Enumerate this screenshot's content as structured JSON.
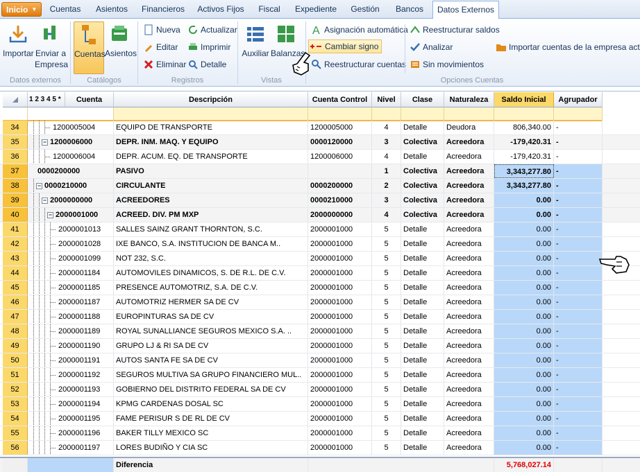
{
  "menu": {
    "inicio": "Inicio",
    "tabs": [
      "Cuentas",
      "Asientos",
      "Financieros",
      "Activos Fijos",
      "Fiscal",
      "Expediente",
      "Gestión",
      "Bancos",
      "Datos Externos"
    ]
  },
  "ribbon": {
    "importar": "Importar",
    "enviar_line1": "Enviar a",
    "enviar_line2": "Empresa",
    "datos_externos": "Datos externos",
    "cuentas": "Cuentas",
    "asientos": "Asientos",
    "catalogos": "Catálogos",
    "nueva": "Nueva",
    "actualizar": "Actualizar",
    "editar": "Editar",
    "imprimir": "Imprimir",
    "eliminar": "Eliminar",
    "detalle": "Detalle",
    "registros": "Registros",
    "auxiliar": "Auxiliar",
    "balanzas": "Balanzas",
    "vistas": "Vistas",
    "asignacion_automatica": "Asignación automática",
    "cambiar_signo": "Cambiar signo",
    "reestructurar_cuentas": "Reestructurar cuentas",
    "reestructurar_saldos": "Reestructurar saldos",
    "analizar": "Analizar",
    "sin_movimientos": "Sin movimientos",
    "importar_cuentas_empresa": "Importar cuentas de la empresa actual",
    "opciones_cuentas": "Opciones Cuentas"
  },
  "grid": {
    "level_header": "1 2 3 4 5 *",
    "columns": [
      "Cuenta",
      "Descripción",
      "Cuenta Control",
      "Nivel",
      "Clase",
      "Naturaleza",
      "Saldo Inicial",
      "Agrupador"
    ],
    "rows": [
      {
        "n": "34",
        "cuenta": "1200005004",
        "desc": "EQUIPO DE TRANSPORTE",
        "control": "1200005000",
        "nivel": "4",
        "clase": "Detalle",
        "nat": "Deudora",
        "saldo": "806,340.00",
        "agr": "-"
      },
      {
        "n": "35",
        "cuenta": "1200006000",
        "desc": "DEPR. INM. MAQ. Y EQUIPO",
        "control": "0000120000",
        "nivel": "3",
        "clase": "Colectiva",
        "nat": "Acreedora",
        "saldo": "-179,420.31",
        "agr": "-"
      },
      {
        "n": "36",
        "cuenta": "1200006004",
        "desc": "DEPR. ACUM. EQ. DE TRANSPORTE",
        "control": "1200006000",
        "nivel": "4",
        "clase": "Detalle",
        "nat": "Acreedora",
        "saldo": "-179,420.31",
        "agr": "-"
      },
      {
        "n": "37",
        "cuenta": "0000200000",
        "desc": "PASIVO",
        "control": "",
        "nivel": "1",
        "clase": "Colectiva",
        "nat": "Acreedora",
        "saldo": "3,343,277.80",
        "agr": "-"
      },
      {
        "n": "38",
        "cuenta": "0000210000",
        "desc": "CIRCULANTE",
        "control": "0000200000",
        "nivel": "2",
        "clase": "Colectiva",
        "nat": "Acreedora",
        "saldo": "3,343,277.80",
        "agr": "-"
      },
      {
        "n": "39",
        "cuenta": "2000000000",
        "desc": "ACREEDORES",
        "control": "0000210000",
        "nivel": "3",
        "clase": "Colectiva",
        "nat": "Acreedora",
        "saldo": "0.00",
        "agr": "-"
      },
      {
        "n": "40",
        "cuenta": "2000001000",
        "desc": "ACREED. DIV. PM MXP",
        "control": "2000000000",
        "nivel": "4",
        "clase": "Colectiva",
        "nat": "Acreedora",
        "saldo": "0.00",
        "agr": "-"
      },
      {
        "n": "41",
        "cuenta": "2000001013",
        "desc": "SALLES SAINZ GRANT THORNTON, S.C.",
        "control": "2000001000",
        "nivel": "5",
        "clase": "Detalle",
        "nat": "Acreedora",
        "saldo": "0.00",
        "agr": "-"
      },
      {
        "n": "42",
        "cuenta": "2000001028",
        "desc": "IXE BANCO, S.A. INSTITUCION DE BANCA M..",
        "control": "2000001000",
        "nivel": "5",
        "clase": "Detalle",
        "nat": "Acreedora",
        "saldo": "0.00",
        "agr": "-"
      },
      {
        "n": "43",
        "cuenta": "2000001099",
        "desc": "NOT 232, S.C.",
        "control": "2000001000",
        "nivel": "5",
        "clase": "Detalle",
        "nat": "Acreedora",
        "saldo": "0.00",
        "agr": "-"
      },
      {
        "n": "44",
        "cuenta": "2000001184",
        "desc": "AUTOMOVILES DINAMICOS, S. DE R.L. DE C.V.",
        "control": "2000001000",
        "nivel": "5",
        "clase": "Detalle",
        "nat": "Acreedora",
        "saldo": "0.00",
        "agr": "-"
      },
      {
        "n": "45",
        "cuenta": "2000001185",
        "desc": "PRESENCE AUTOMOTRIZ, S.A. DE C.V.",
        "control": "2000001000",
        "nivel": "5",
        "clase": "Detalle",
        "nat": "Acreedora",
        "saldo": "0.00",
        "agr": "-"
      },
      {
        "n": "46",
        "cuenta": "2000001187",
        "desc": "AUTOMOTRIZ HERMER SA DE CV",
        "control": "2000001000",
        "nivel": "5",
        "clase": "Detalle",
        "nat": "Acreedora",
        "saldo": "0.00",
        "agr": "-"
      },
      {
        "n": "47",
        "cuenta": "2000001188",
        "desc": "EUROPINTURAS SA DE CV",
        "control": "2000001000",
        "nivel": "5",
        "clase": "Detalle",
        "nat": "Acreedora",
        "saldo": "0.00",
        "agr": "-"
      },
      {
        "n": "48",
        "cuenta": "2000001189",
        "desc": "ROYAL SUNALLIANCE SEGUROS MEXICO S.A. ..",
        "control": "2000001000",
        "nivel": "5",
        "clase": "Detalle",
        "nat": "Acreedora",
        "saldo": "0.00",
        "agr": "-"
      },
      {
        "n": "49",
        "cuenta": "2000001190",
        "desc": "GRUPO LJ & RI SA DE CV",
        "control": "2000001000",
        "nivel": "5",
        "clase": "Detalle",
        "nat": "Acreedora",
        "saldo": "0.00",
        "agr": "-"
      },
      {
        "n": "50",
        "cuenta": "2000001191",
        "desc": "AUTOS SANTA FE SA DE CV",
        "control": "2000001000",
        "nivel": "5",
        "clase": "Detalle",
        "nat": "Acreedora",
        "saldo": "0.00",
        "agr": "-"
      },
      {
        "n": "51",
        "cuenta": "2000001192",
        "desc": "SEGUROS MULTIVA SA GRUPO FINANCIERO MUL..",
        "control": "2000001000",
        "nivel": "5",
        "clase": "Detalle",
        "nat": "Acreedora",
        "saldo": "0.00",
        "agr": "-"
      },
      {
        "n": "52",
        "cuenta": "2000001193",
        "desc": "GOBIERNO DEL DISTRITO FEDERAL SA DE CV",
        "control": "2000001000",
        "nivel": "5",
        "clase": "Detalle",
        "nat": "Acreedora",
        "saldo": "0.00",
        "agr": "-"
      },
      {
        "n": "53",
        "cuenta": "2000001194",
        "desc": "KPMG CARDENAS DOSAL SC",
        "control": "2000001000",
        "nivel": "5",
        "clase": "Detalle",
        "nat": "Acreedora",
        "saldo": "0.00",
        "agr": "-"
      },
      {
        "n": "54",
        "cuenta": "2000001195",
        "desc": "FAME PERISUR S DE RL DE CV",
        "control": "2000001000",
        "nivel": "5",
        "clase": "Detalle",
        "nat": "Acreedora",
        "saldo": "0.00",
        "agr": "-"
      },
      {
        "n": "55",
        "cuenta": "2000001196",
        "desc": "BAKER TILLY MEXICO SC",
        "control": "2000001000",
        "nivel": "5",
        "clase": "Detalle",
        "nat": "Acreedora",
        "saldo": "0.00",
        "agr": "-"
      },
      {
        "n": "56",
        "cuenta": "2000001197",
        "desc": "LORES BUDIÑO Y CIA SC",
        "control": "2000001000",
        "nivel": "5",
        "clase": "Detalle",
        "nat": "Acreedora",
        "saldo": "0.00",
        "agr": "-"
      }
    ],
    "footer_label": "Diferencia",
    "footer_value": "5,768,027.14"
  },
  "colors": {
    "accent": "#f7c23a",
    "selection": "#b9d7f8",
    "negative": "#e00000"
  }
}
